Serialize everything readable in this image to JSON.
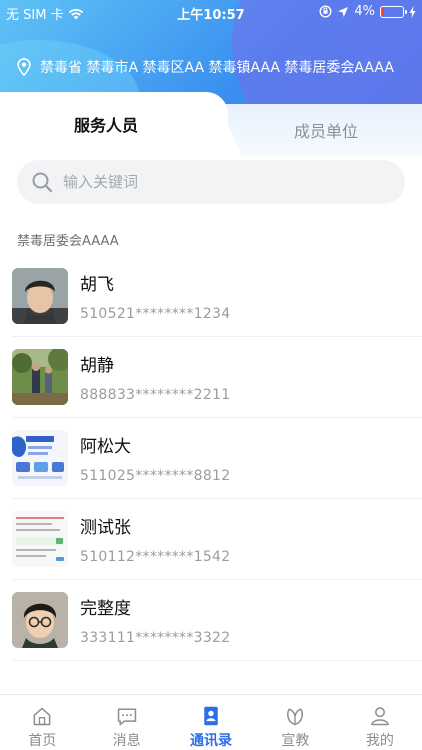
{
  "status_bar": {
    "carrier": "无 SIM 卡",
    "time": "上午10:57",
    "battery_percent": "4%",
    "battery_level": 0.04
  },
  "location": {
    "text": "禁毒省 禁毒市A 禁毒区AA 禁毒镇AAA 禁毒居委会AAAA",
    "icon": "location-pin-icon"
  },
  "tabs": [
    {
      "label": "服务人员",
      "active": true
    },
    {
      "label": "成员单位",
      "active": false
    }
  ],
  "search": {
    "placeholder": "输入关键词",
    "value": ""
  },
  "group": {
    "label": "禁毒居委会AAAA"
  },
  "people": [
    {
      "name": "胡飞",
      "id_number": "510521********1234"
    },
    {
      "name": "胡静",
      "id_number": "888833********2211"
    },
    {
      "name": "阿松大",
      "id_number": "511025********8812"
    },
    {
      "name": "测试张",
      "id_number": "510112********1542"
    },
    {
      "name": "完整度",
      "id_number": "333111********3322"
    }
  ],
  "bottom_nav": [
    {
      "label": "首页",
      "icon": "home-icon",
      "active": false
    },
    {
      "label": "消息",
      "icon": "message-icon",
      "active": false
    },
    {
      "label": "通讯录",
      "icon": "contacts-icon",
      "active": true
    },
    {
      "label": "宣教",
      "icon": "education-icon",
      "active": false
    },
    {
      "label": "我的",
      "icon": "profile-icon",
      "active": false
    }
  ],
  "colors": {
    "accent": "#2d6ee8",
    "header_start": "#5ec3f6",
    "header_end": "#3f7fea",
    "battery_low": "#ff3b30"
  }
}
